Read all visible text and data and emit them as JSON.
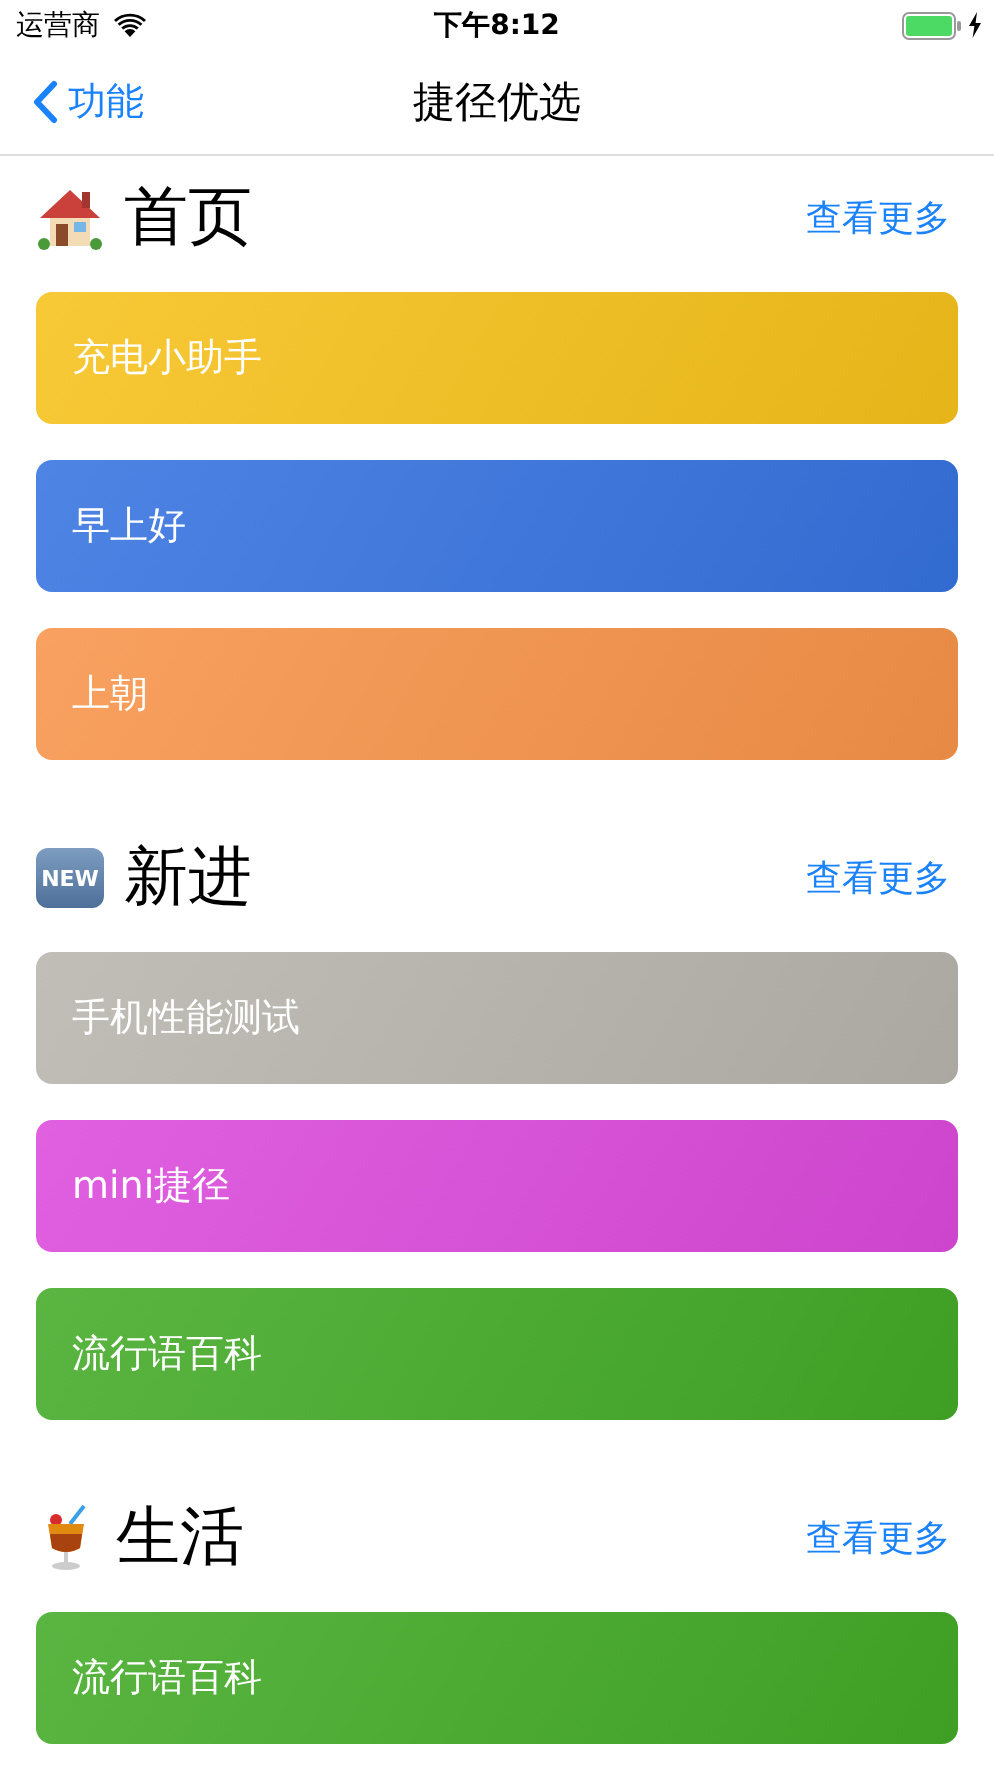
{
  "status_bar": {
    "carrier": "运营商",
    "time": "下午8:12",
    "charging": true
  },
  "nav": {
    "back": "功能",
    "title": "捷径优选"
  },
  "sections": [
    {
      "title": "首页",
      "kind": "house",
      "more": "查看更多",
      "cards": [
        {
          "label": "充电小助手",
          "color": "#f7c21b"
        },
        {
          "label": "早上好",
          "color": "#3673e0"
        },
        {
          "label": "上朝",
          "color": "#f8944a"
        }
      ]
    },
    {
      "title": "新进",
      "kind": "new",
      "badge": "NEW",
      "more": "查看更多",
      "cards": [
        {
          "label": "手机性能测试",
          "color": "#b8b5ae"
        },
        {
          "label": "mini捷径",
          "color": "#dc4adc"
        },
        {
          "label": "流行语百科",
          "color": "#43ab27"
        }
      ]
    },
    {
      "title": "生活",
      "kind": "cocktail",
      "more": "查看更多",
      "cards": [
        {
          "label": "流行语百科",
          "color": "#43ab27"
        }
      ]
    }
  ]
}
